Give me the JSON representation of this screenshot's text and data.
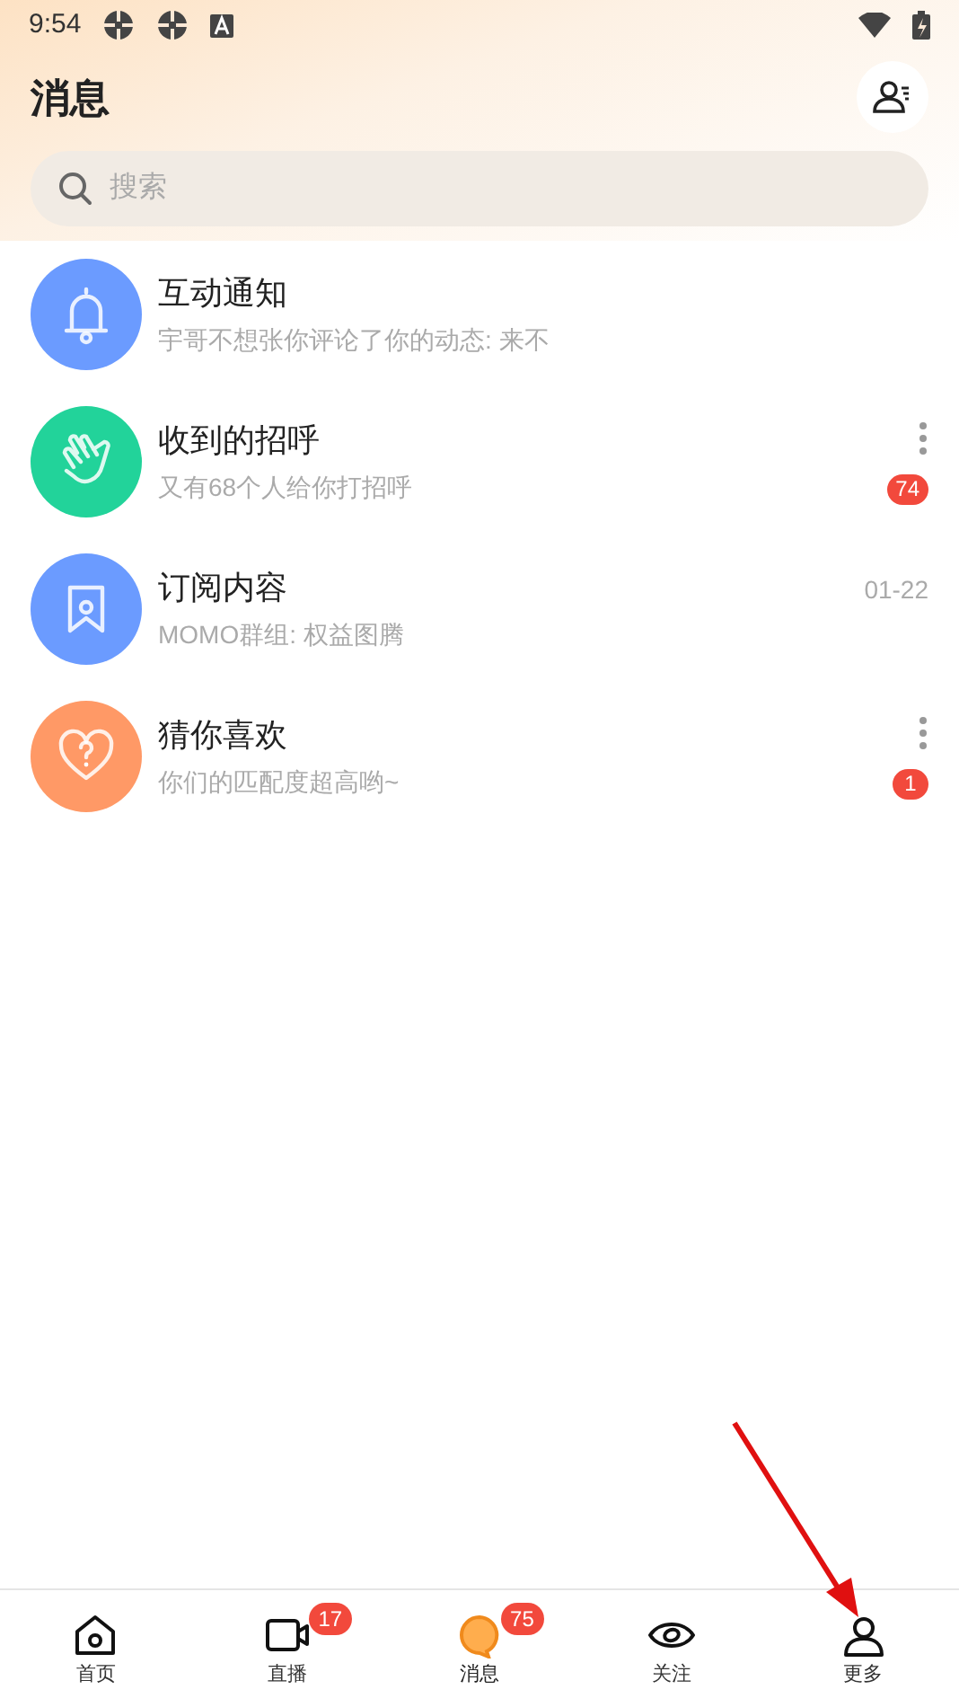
{
  "status_bar": {
    "time": "9:54"
  },
  "header": {
    "title": "消息"
  },
  "search": {
    "placeholder": "搜索"
  },
  "conversations": [
    {
      "kind": "bell",
      "color": "#6b9bff",
      "title": "互动通知",
      "subtitle": "宇哥不想张你评论了你的动态: 来不",
      "more": false
    },
    {
      "kind": "wave",
      "color": "#22d39a",
      "title": "收到的招呼",
      "subtitle": "又有68个人给你打招呼",
      "more": true,
      "badge": "74"
    },
    {
      "kind": "bookmark",
      "color": "#6b9bff",
      "title": "订阅内容",
      "subtitle": "MOMO群组: 权益图腾",
      "more": false,
      "time": "01-22"
    },
    {
      "kind": "heart",
      "color": "#ff9966",
      "title": "猜你喜欢",
      "subtitle": "你们的匹配度超高哟~",
      "more": true,
      "badge": "1"
    }
  ],
  "tabs": [
    {
      "kind": "home",
      "label": "首页",
      "selected": false
    },
    {
      "kind": "video",
      "label": "直播",
      "selected": false,
      "badge": "17"
    },
    {
      "kind": "chat",
      "label": "消息",
      "selected": true,
      "badge": "75"
    },
    {
      "kind": "eye",
      "label": "关注",
      "selected": false
    },
    {
      "kind": "person",
      "label": "更多",
      "selected": false
    }
  ]
}
